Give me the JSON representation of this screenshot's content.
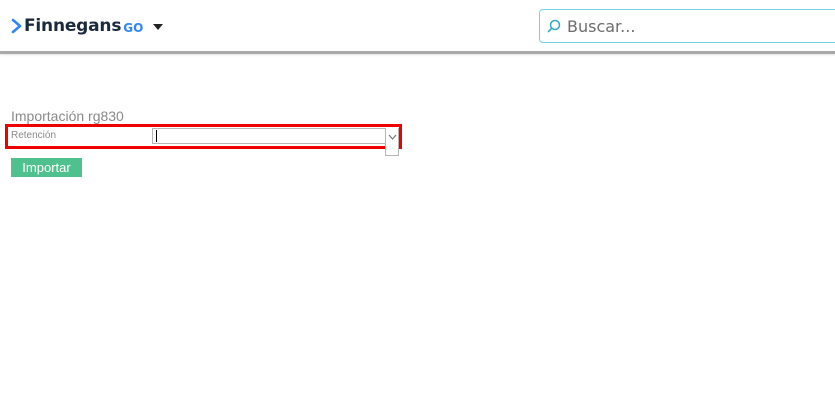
{
  "header": {
    "brand_name": "Finnegans",
    "brand_suffix": "GO",
    "brand_icon": "chevron-right-icon",
    "menu_icon": "caret-down-icon",
    "search": {
      "placeholder": "Buscar...",
      "value": "",
      "icon": "search-icon"
    }
  },
  "form": {
    "title": "Importación rg830",
    "field": {
      "label": "Retención",
      "value": "",
      "dropdown_icon": "chevron-down-icon"
    },
    "import_button_label": "Importar"
  },
  "colors": {
    "brand_accent": "#2f86f6",
    "brand_text": "#1b2a3d",
    "search_border": "#6fd3df",
    "highlight": "#ee0000",
    "button": "#4fc18f"
  }
}
